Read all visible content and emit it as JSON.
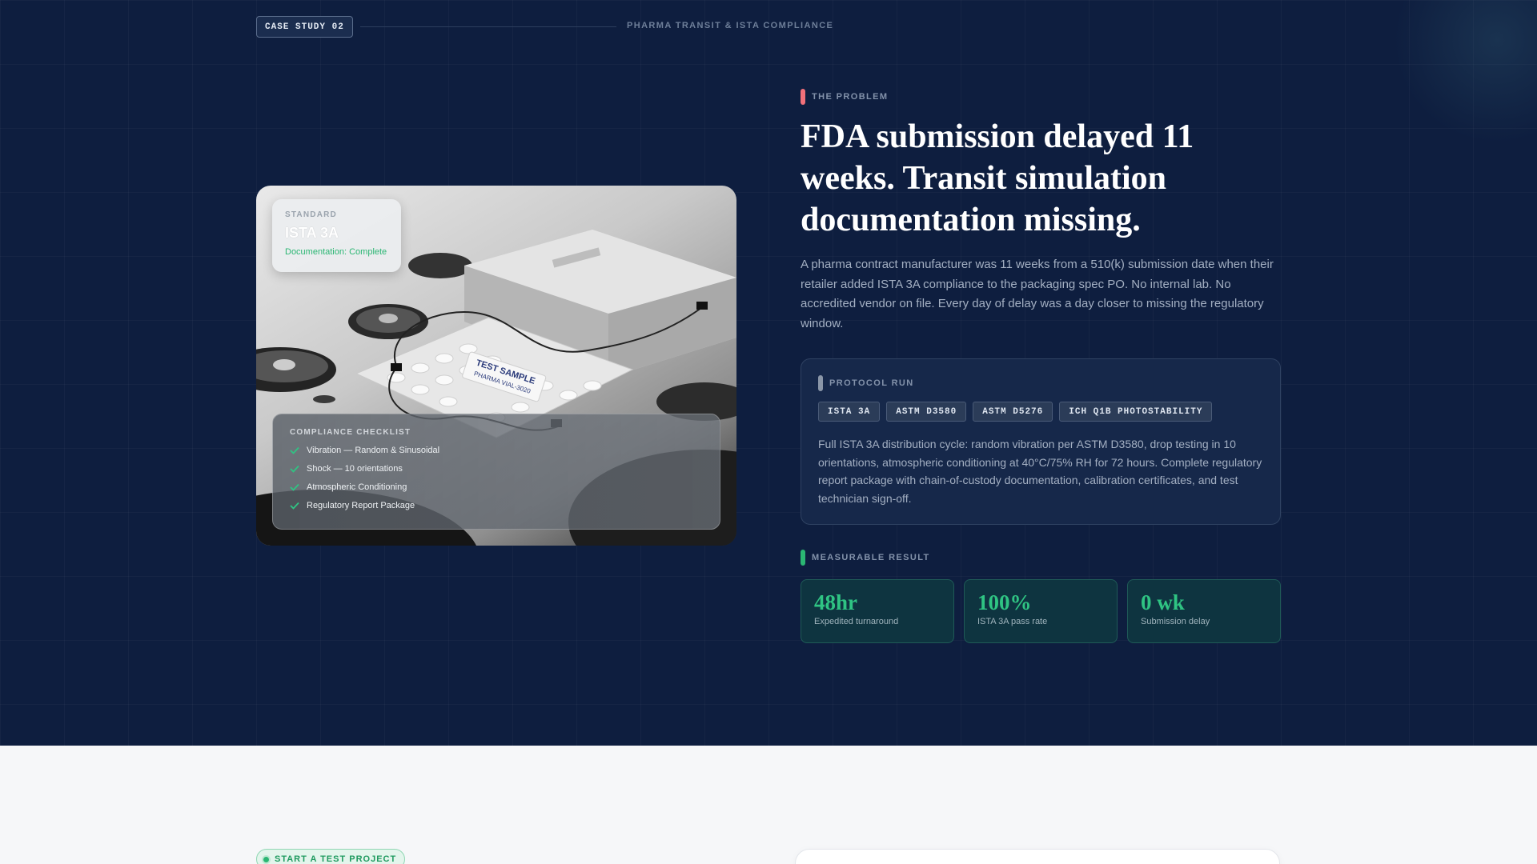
{
  "header": {
    "badge": "CASE STUDY 02",
    "caption": "PHARMA TRANSIT & ISTA COMPLIANCE"
  },
  "image_card": {
    "sample_label_line1": "TEST SAMPLE",
    "sample_label_line2": "PHARMA VIAL-3020",
    "standard": {
      "label": "STANDARD",
      "title": "ISTA 3A",
      "status": "Documentation: Complete"
    },
    "checklist": {
      "title": "COMPLIANCE CHECKLIST",
      "items": [
        "Vibration — Random & Sinusoidal",
        "Shock — 10 orientations",
        "Atmospheric Conditioning",
        "Regulatory Report Package"
      ]
    }
  },
  "problem": {
    "label": "THE PROBLEM",
    "headline": "FDA submission delayed 11 weeks. Transit simulation documentation missing.",
    "body": "A pharma contract manufacturer was 11 weeks from a 510(k) submission date when their retailer added ISTA 3A compliance to the packaging spec PO. No internal lab. No accredited vendor on file. Every day of delay was a day closer to missing the regulatory window."
  },
  "protocol": {
    "label": "PROTOCOL RUN",
    "tags": [
      "ISTA 3A",
      "ASTM D3580",
      "ASTM D5276",
      "ICH Q1B PHOTOSTABILITY"
    ],
    "body": "Full ISTA 3A distribution cycle: random vibration per ASTM D3580, drop testing in 10 orientations, atmospheric conditioning at 40°C/75% RH for 72 hours. Complete regulatory report package with chain-of-custody documentation, calibration certificates, and test technician sign-off."
  },
  "result": {
    "label": "MEASURABLE RESULT",
    "metrics": [
      {
        "value": "48hr",
        "label": "Expedited turnaround"
      },
      {
        "value": "100%",
        "label": "ISTA 3A pass rate"
      },
      {
        "value": "0 wk",
        "label": "Submission delay"
      }
    ]
  },
  "cta": {
    "label": "START A TEST PROJECT"
  },
  "colors": {
    "background": "#0e1e3f",
    "accent_green": "#2fc483",
    "problem_marker": "#f0707a",
    "protocol_marker": "#8a96a8",
    "result_marker": "#2bb673"
  },
  "icons": {
    "checklist": "check-icon",
    "cta": "status-dot-icon"
  }
}
